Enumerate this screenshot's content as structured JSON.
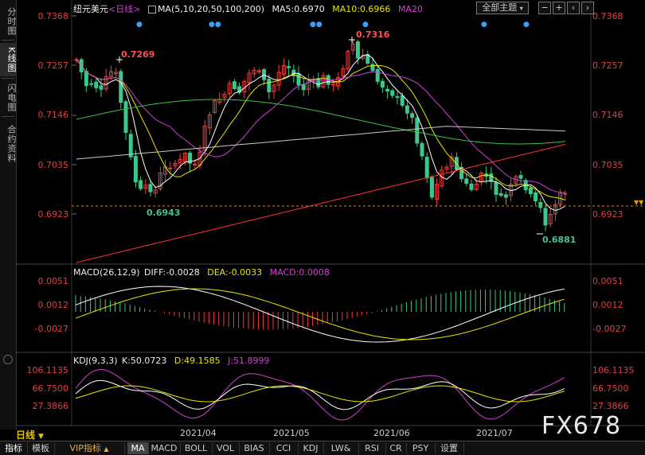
{
  "sidebar": {
    "tabs": [
      "分时图",
      "K线图",
      "闪电图",
      "合约资料"
    ]
  },
  "header": {
    "instrument": "纽元美元",
    "period_tag": "<日线>",
    "ma_label": "MA(5,10,20,50,100,200)",
    "ma5": "MA5:0.6970",
    "ma10": "MA10:0.6966",
    "ma20": "MA20",
    "theme_button": "全部主题"
  },
  "price_axis": {
    "ticks": [
      "0.7368",
      "0.7257",
      "0.7146",
      "0.7035",
      "0.6923"
    ]
  },
  "annotations": {
    "high1": "0.7269",
    "high2": "0.7316",
    "low1": "0.6943",
    "low2": "0.6881"
  },
  "macd": {
    "label": "MACD(26,12,9)",
    "diff": "DIFF:-0.0028",
    "dea": "DEA:-0.0033",
    "macd": "MACD:0.0008",
    "ticks": [
      "0.0051",
      "0.0012",
      "-0.0027"
    ]
  },
  "kdj": {
    "label": "KDJ(9,3,3)",
    "k": "K:50.0723",
    "d": "D:49.1585",
    "j": "J:51.8999",
    "ticks": [
      "106.1135",
      "66.7500",
      "27.3866"
    ]
  },
  "dates": [
    "2021/04",
    "2021/05",
    "2021/06",
    "2021/07"
  ],
  "period_button": "日线",
  "bottom_tabs": [
    "指标",
    "模板",
    "VIP指标",
    "MA",
    "MACD",
    "BOLL",
    "VOL",
    "BIAS",
    "CCI",
    "KDJ",
    "LW&",
    "RSI",
    "CR",
    "PSY",
    "设置"
  ],
  "watermark": "FX678",
  "colors": {
    "up": "#f03c3c",
    "down": "#3cc88c",
    "ma5": "#ffffff",
    "ma10": "#e6e600",
    "ma20": "#d040d0",
    "ma50": "#40c040",
    "ma100": "#c8c8c8",
    "ma200": "#ff3030"
  }
}
